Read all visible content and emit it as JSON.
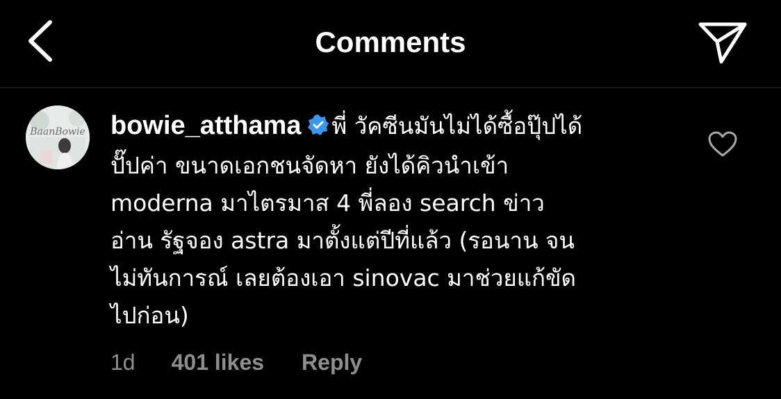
{
  "header": {
    "title": "Comments",
    "back_icon": "chevron-left-icon",
    "share_icon": "paper-plane-icon"
  },
  "comment": {
    "username": "bowie_atthama",
    "verified": true,
    "avatar_text": "BaanBowie",
    "lines": [
      "พี่ วัคซีนมันไม่ได้ซื้อปุ๊ปได้",
      "ปั๊ปค่า ขนาดเอกชนจัดหา ยังได้คิวนำเข้า",
      "moderna มาไตรมาส 4 พี่ลอง search ข่าว",
      "อ่าน รัฐจอง astra มาตั้งแต่ปีที่แล้ว (รอนาน จน",
      "ไม่ทันการณ์ เลยต้องเอา sinovac มาช่วยแก้ขัด",
      "ไปก่อน)"
    ],
    "time": "1d",
    "likes": "401 likes",
    "reply_label": "Reply",
    "like_icon": "heart-outline-icon"
  },
  "colors": {
    "background": "#000000",
    "text": "#ffffff",
    "muted": "#8e8e8e",
    "verified_blue": "#3897f0"
  }
}
